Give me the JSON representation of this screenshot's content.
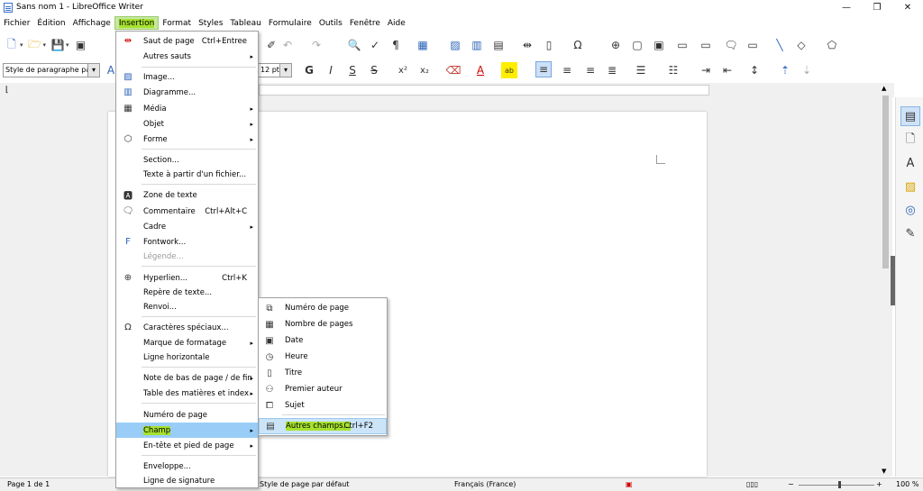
{
  "window": {
    "title": "Sans nom 1 - LibreOffice Writer",
    "minimize": "—",
    "maximize": "❐",
    "close": "✕"
  },
  "menubar": [
    "Fichier",
    "Édition",
    "Affichage",
    "Insertion",
    "Format",
    "Styles",
    "Tableau",
    "Formulaire",
    "Outils",
    "Fenêtre",
    "Aide"
  ],
  "toolbar": {
    "paragraph_style": "Style de paragraphe par",
    "font_size": "12 pt",
    "bold": "G",
    "italic": "I",
    "underline": "S",
    "strike": "S",
    "superscript": "x²",
    "subscript": "x₂",
    "font_color": "A",
    "highlight": "ab"
  },
  "insert_menu": [
    {
      "label": "Saut de page",
      "shortcut": "Ctrl+Entree",
      "icon": "page-break-icon"
    },
    {
      "label": "Autres sauts",
      "submenu": true
    },
    {
      "label": "Image...",
      "icon": "image-icon"
    },
    {
      "label": "Diagramme...",
      "icon": "chart-icon"
    },
    {
      "label": "Média",
      "submenu": true,
      "icon": "media-icon"
    },
    {
      "label": "Objet",
      "submenu": true
    },
    {
      "label": "Forme",
      "submenu": true,
      "icon": "shape-icon"
    },
    {
      "label": "Section..."
    },
    {
      "label": "Texte à partir d'un fichier..."
    },
    {
      "label": "Zone de texte",
      "icon": "textbox-icon"
    },
    {
      "label": "Commentaire",
      "shortcut": "Ctrl+Alt+C",
      "icon": "comment-icon"
    },
    {
      "label": "Cadre",
      "submenu": true
    },
    {
      "label": "Fontwork...",
      "icon": "fontwork-icon"
    },
    {
      "label": "Légende...",
      "disabled": true
    },
    {
      "label": "Hyperlien...",
      "shortcut": "Ctrl+K",
      "icon": "hyperlink-icon"
    },
    {
      "label": "Repère de texte..."
    },
    {
      "label": "Renvoi..."
    },
    {
      "label": "Caractères spéciaux...",
      "icon": "omega-icon"
    },
    {
      "label": "Marque de formatage",
      "submenu": true
    },
    {
      "label": "Ligne horizontale"
    },
    {
      "label": "Note de bas de page / de fin",
      "submenu": true
    },
    {
      "label": "Table des matières et index",
      "submenu": true
    },
    {
      "label": "Numéro de page"
    },
    {
      "label": "Champ",
      "submenu": true,
      "highlighted": true
    },
    {
      "label": "En-tête et pied de page",
      "submenu": true
    },
    {
      "label": "Enveloppe..."
    },
    {
      "label": "Ligne de signature"
    }
  ],
  "field_submenu": [
    {
      "label": "Numéro de page",
      "icon": "page-number-icon"
    },
    {
      "label": "Nombre de pages",
      "icon": "page-count-icon"
    },
    {
      "label": "Date",
      "icon": "calendar-icon"
    },
    {
      "label": "Heure",
      "icon": "clock-icon"
    },
    {
      "label": "Titre",
      "icon": "document-icon"
    },
    {
      "label": "Premier auteur",
      "icon": "person-icon"
    },
    {
      "label": "Sujet",
      "icon": "subject-icon"
    },
    {
      "label": "Autres champs...",
      "shortcut": "Ctrl+F2",
      "icon": "fields-icon",
      "highlighted": true
    }
  ],
  "statusbar": {
    "page": "Page 1 de 1",
    "page_style": "Style de page par défaut",
    "language": "Français (France)",
    "zoom": "100 %"
  }
}
